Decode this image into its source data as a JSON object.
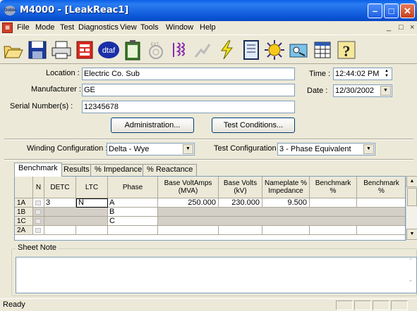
{
  "window": {
    "title": "M4000 - [LeakReac1]",
    "app_badge": "Doble"
  },
  "menu": {
    "items": [
      "File",
      "Mode",
      "Test",
      "Diagnostics",
      "View",
      "Tools",
      "Window",
      "Help"
    ],
    "mdi_minimize": "_",
    "mdi_restore": "□",
    "mdi_close": "×"
  },
  "toolbar": {
    "icons": [
      "open-folder-icon",
      "save-disk-icon",
      "print-icon",
      "report-icon",
      "dtaf-icon",
      "clipboard-icon",
      "ext-icon",
      "winding-icon",
      "chart-icon",
      "lightning-icon",
      "notebook-icon",
      "sun-icon",
      "tools-icon",
      "spreadsheet-icon",
      "help-icon"
    ],
    "dtaf_label": "dtaf",
    "ext_label": "EXT."
  },
  "form": {
    "location_label": "Location :",
    "location_value": "Electric Co. Sub",
    "manufacturer_label": "Manufacturer :",
    "manufacturer_value": "GE",
    "serial_label": "Serial Number(s) :",
    "serial_value": "12345678",
    "time_label": "Time :",
    "time_value": "12:44:02 PM",
    "date_label": "Date :",
    "date_value": "12/30/2002",
    "administration_button": "Administration...",
    "test_conditions_button": "Test Conditions..."
  },
  "config": {
    "winding_label": "Winding Configuration :",
    "winding_value": "Delta - Wye",
    "test_label": "Test Configuration :",
    "test_value": "3 - Phase Equivalent"
  },
  "tabs": [
    "Benchmark",
    "Results",
    "% Impedance",
    "% Reactance"
  ],
  "grid": {
    "headers": [
      "N",
      "DETC",
      "LTC",
      "Phase",
      "Base VoltAmps\n(MVA)",
      "Base Volts\n(kV)",
      "Nameplate %\nImpedance",
      "Benchmark\n%",
      "Benchmark\n%"
    ],
    "rows": [
      {
        "label": "1A",
        "detc": "3",
        "ltc": "N",
        "phase": "A",
        "mva": "250.000",
        "kv": "230.000",
        "imp": "9.500"
      },
      {
        "label": "1B",
        "detc": "",
        "ltc": "",
        "phase": "B",
        "mva": "",
        "kv": "",
        "imp": ""
      },
      {
        "label": "1C",
        "detc": "",
        "ltc": "",
        "phase": "C",
        "mva": "",
        "kv": "",
        "imp": ""
      },
      {
        "label": "2A",
        "detc": "",
        "ltc": "",
        "phase": "",
        "mva": "",
        "kv": "",
        "imp": ""
      }
    ]
  },
  "sheet_note": {
    "label": "Sheet Note",
    "value": ""
  },
  "status": {
    "text": "Ready"
  }
}
